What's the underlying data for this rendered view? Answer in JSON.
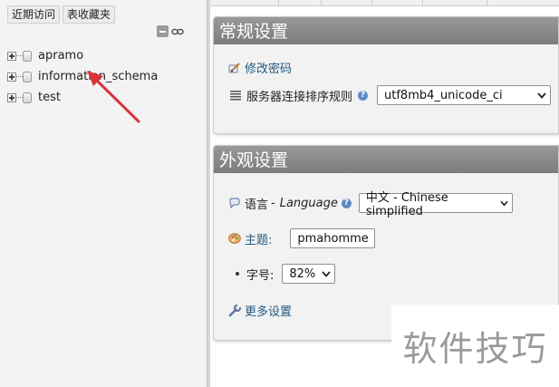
{
  "nav": {
    "tabs": [
      "近期访问",
      "表收藏夹"
    ],
    "databases": [
      "apramo",
      "information_schema",
      "test"
    ]
  },
  "general_settings": {
    "title": "常规设置",
    "change_password": "修改密码",
    "collation_label": "服务器连接排序规则",
    "collation_value": "utf8mb4_unicode_ci"
  },
  "appearance_settings": {
    "title": "外观设置",
    "language_label": "语言",
    "language_label_en": "Language",
    "language_value": "中文 - Chinese simplified",
    "theme_label": "主题:",
    "theme_value": "pmahomme",
    "font_size_label": "字号:",
    "font_size_value": "82%",
    "more_settings": "更多设置"
  },
  "help_icon_text": "?",
  "watermark": "软件技巧",
  "colors": {
    "panel_header": "#888888",
    "link": "#235a81",
    "arrow": "#d9343a"
  }
}
